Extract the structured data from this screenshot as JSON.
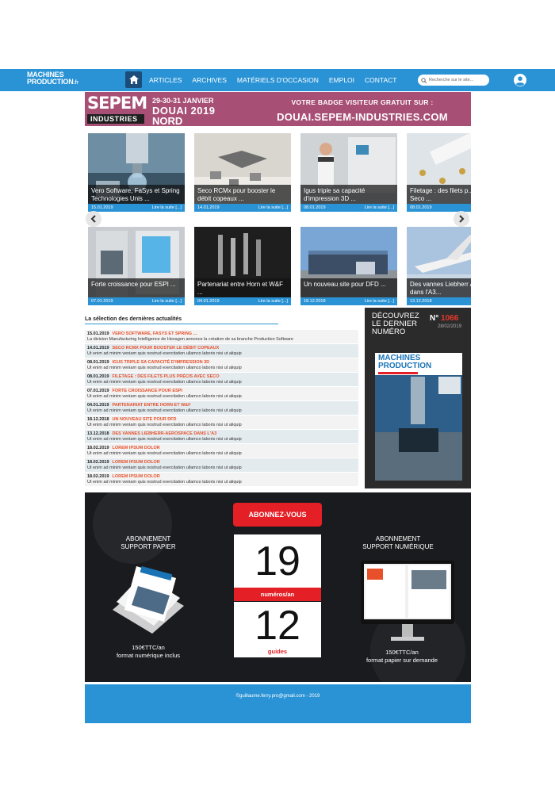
{
  "header": {
    "logo_line1": "MACHINES",
    "logo_line2": "PRODUCTION",
    "logo_suffix": ".fr",
    "nav": [
      "ARTICLES",
      "ARCHIVES",
      "MATÉRIELS D'OCCASION",
      "EMPLOI",
      "CONTACT"
    ],
    "search_placeholder": "Recherche sur le site...",
    "color_bar": "#2a93d5"
  },
  "banner": {
    "logo_text": "SEPEM",
    "logo_subtext": "INDUSTRIES",
    "dates": "29-30-31 JANVIER",
    "city_year": "DOUAI 2019",
    "region": "NORD",
    "badge_line": "VOTRE BADGE VISITEUR GRATUIT SUR :",
    "url": "DOUAI.SEPEM-INDUSTRIES.COM"
  },
  "carousel": {
    "read_more": "Lire la suite [...]",
    "row1": [
      {
        "title": "Vero Software, FaSys et Spring Technologies Unis ...",
        "date": "15.01.2019"
      },
      {
        "title": "Seco RCMx pour booster le débit copeaux ...",
        "date": "14.01.2019"
      },
      {
        "title": "Igus triple sa capacité d'impression 3D ...",
        "date": "08.01.2019"
      },
      {
        "title": "Filetage : des filets p... avec Seco ...",
        "date": "08.01.2019"
      }
    ],
    "row2": [
      {
        "title": "Forte croissance pour ESPI ...",
        "date": "07.01.2019"
      },
      {
        "title": "Partenariat entre Horn et W&F ...",
        "date": "04.01.2019"
      },
      {
        "title": "Un nouveau site pour DFD ...",
        "date": "18.12.2018"
      },
      {
        "title": "Des vannes Liebherr Aerospace dans l'A3...",
        "date": "13.12.2018"
      }
    ]
  },
  "news": {
    "heading": "La sélection des dernières actualités",
    "items": [
      {
        "date": "15.01.2019",
        "title": "VERO SOFTWARE, FASYS ET SPRING ...",
        "desc": "La division Manufacturing Intelligence de Hexagon annonce la création de sa branche Production Software"
      },
      {
        "date": "14.01.2019",
        "title": "SECO RCMX POUR BOOSTER LE DÉBIT COPEAUX",
        "desc": "Ut enim ad minim veniam quis nostrud exercitation ullamco laboris nisi ut aliquip"
      },
      {
        "date": "08.01.2019",
        "title": "IGUS TRIPLE SA CAPACITÉ D'IMPRESSION 3D",
        "desc": "Ut enim ad minim veniam quis nostrud exercitation ullamco laboris nisi ut aliquip"
      },
      {
        "date": "08.01.2019",
        "title": "FILETAGE : DES FILETS PLUS PRÉCIS AVEC SECO",
        "desc": "Ut enim ad minim veniam quis nostrud exercitation ullamco laboris nisi ut aliquip"
      },
      {
        "date": "07.01.2019",
        "title": "FORTE CROISSANCE POUR ESPI",
        "desc": "Ut enim ad minim veniam quis nostrud exercitation ullamco laboris nisi ut aliquip"
      },
      {
        "date": "04.01.2019",
        "title": "PARTENARIAT ENTRE HORN ET W&F",
        "desc": "Ut enim ad minim veniam quis nostrud exercitation ullamco laboris nisi ut aliquip"
      },
      {
        "date": "18.12.2018",
        "title": "UN NOUVEAU SITE POUR DFD",
        "desc": "Ut enim ad minim veniam quis nostrud exercitation ullamco laboris nisi ut aliquip"
      },
      {
        "date": "13.12.2018",
        "title": "DES VANNES LIEBHERR-AEROSPACE DANS L'A3",
        "desc": "Ut enim ad minim veniam quis nostrud exercitation ullamco laboris nisi ut aliquip"
      },
      {
        "date": "18.02.2019",
        "title": "LOREM IPSUM DOLOR",
        "desc": "Ut enim ad minim veniam quis nostrud exercitation ullamco laboris nisi ut aliquip"
      },
      {
        "date": "18.02.2019",
        "title": "LOREM IPSUM DOLOR",
        "desc": "Ut enim ad minim veniam quis nostrud exercitation ullamco laboris nisi ut aliquip"
      },
      {
        "date": "18.02.2019",
        "title": "LOREM IPSUM DOLOR",
        "desc": "Ut enim ad minim veniam quis nostrud exercitation ullamco laboris nisi ut aliquip"
      }
    ]
  },
  "magazine": {
    "title_l1": "DÉCOUVREZ",
    "title_l2": "LE DERNIER",
    "title_l3": "NUMÉRO",
    "number_prefix": "N°",
    "number": "1066",
    "date": "28/02/2019",
    "cover_title1": "MACHINES",
    "cover_title2": "PRODUCTION"
  },
  "subscription": {
    "cta": "ABONNEZ-VOUS",
    "left_title_l1": "ABONNEMENT",
    "left_title_l2": "SUPPORT PAPIER",
    "left_price_l1": "150€TTC/an",
    "left_price_l2": "format numérique inclus",
    "right_title_l1": "ABONNEMENT",
    "right_title_l2": "SUPPORT NUMÉRIQUE",
    "right_price_l1": "150€TTC/an",
    "right_price_l2": "format papier sur demande",
    "issues_count": "19",
    "issues_label": "numéros/an",
    "guides_count": "12",
    "guides_label": "guides"
  },
  "footer": {
    "text": "©guillaume.ferry.pro@gmail.com - 2019"
  }
}
